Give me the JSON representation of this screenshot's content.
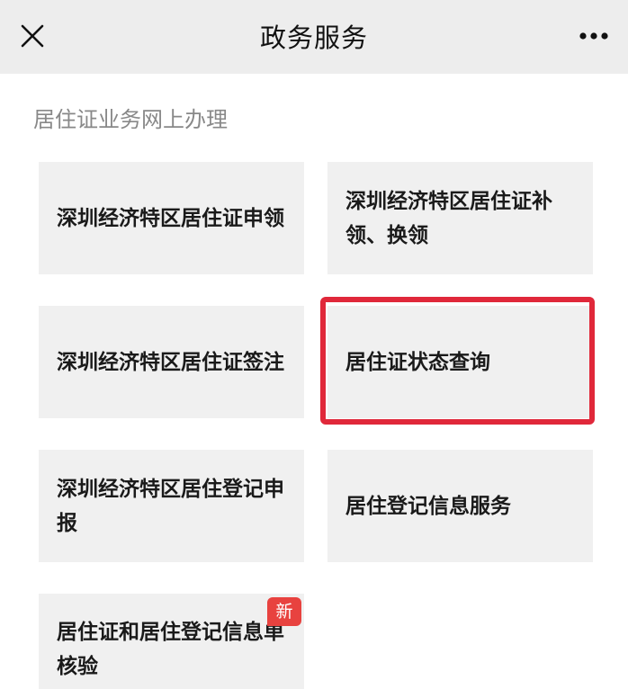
{
  "nav": {
    "title": "政务服务",
    "close_icon": "close-icon",
    "more_icon": "more-icon"
  },
  "section": {
    "title": "居住证业务网上办理"
  },
  "tiles": [
    {
      "label": "深圳经济特区居住证申领"
    },
    {
      "label": "深圳经济特区居住证补领、换领"
    },
    {
      "label": "深圳经济特区居住证签注"
    },
    {
      "label": "居住证状态查询",
      "highlighted": true,
      "highlight_color": "#e0283a"
    },
    {
      "label": "深圳经济特区居住登记申报"
    },
    {
      "label": "居住登记信息服务"
    },
    {
      "label": "居住证和居住登记信息单核验",
      "badge": "新",
      "badge_color": "#e8423f"
    }
  ],
  "colors": {
    "nav_background": "#ededed",
    "tile_background": "#f0f0f0",
    "highlight": "#e0283a",
    "badge": "#e8423f"
  }
}
